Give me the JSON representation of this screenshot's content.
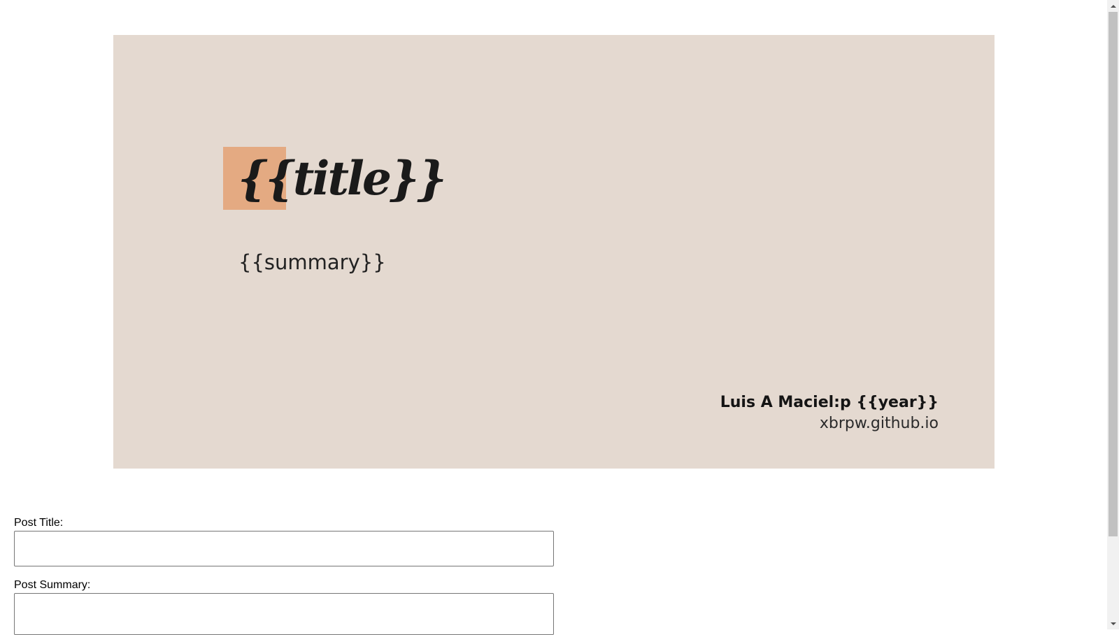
{
  "preview": {
    "title": "{{title}}",
    "summary": "{{summary}}",
    "author": "Luis A Maciel:p {{year}}",
    "site": "xbrpw.github.io"
  },
  "form": {
    "title_label": "Post Title:",
    "title_value": "",
    "summary_label": "Post Summary:",
    "summary_value": ""
  },
  "colors": {
    "card_background": "#e4d9d0",
    "title_accent": "#e4aa82"
  },
  "icons": {
    "scroll_up": "scroll-up-arrow-icon",
    "scroll_down": "scroll-down-arrow-icon"
  }
}
